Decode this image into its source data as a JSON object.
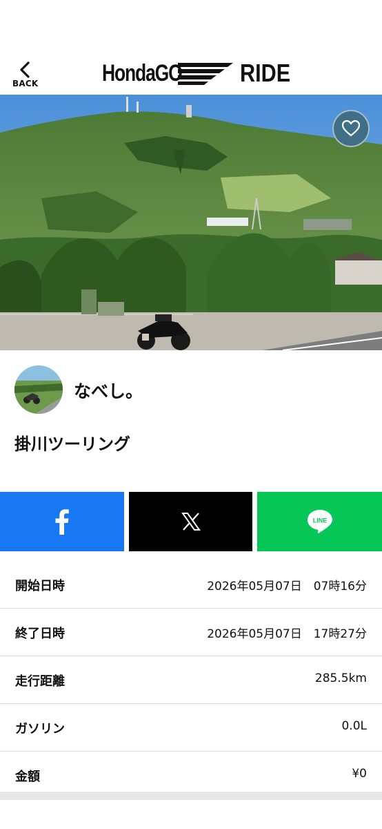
{
  "header": {
    "back_label": "BACK",
    "logo_left": "HondaGO",
    "logo_right": "RIDE"
  },
  "hero": {
    "favorite_icon": "heart-icon"
  },
  "user": {
    "name": "なべし。",
    "ride_title": "掛川ツーリング"
  },
  "share": {
    "facebook_icon": "facebook-icon",
    "x_icon": "x-icon",
    "line_icon": "line-icon",
    "line_text": "LINE",
    "colors": {
      "facebook": "#1877f2",
      "x": "#000000",
      "line": "#06c755"
    }
  },
  "stats": [
    {
      "label": "開始日時",
      "value": "2026年05月07日　07時16分"
    },
    {
      "label": "終了日時",
      "value": "2026年05月07日　17時27分"
    },
    {
      "label": "走行距離",
      "value": "285.5km"
    },
    {
      "label": "ガソリン",
      "value": "0.0L"
    },
    {
      "label": "金額",
      "value": "¥0"
    }
  ]
}
